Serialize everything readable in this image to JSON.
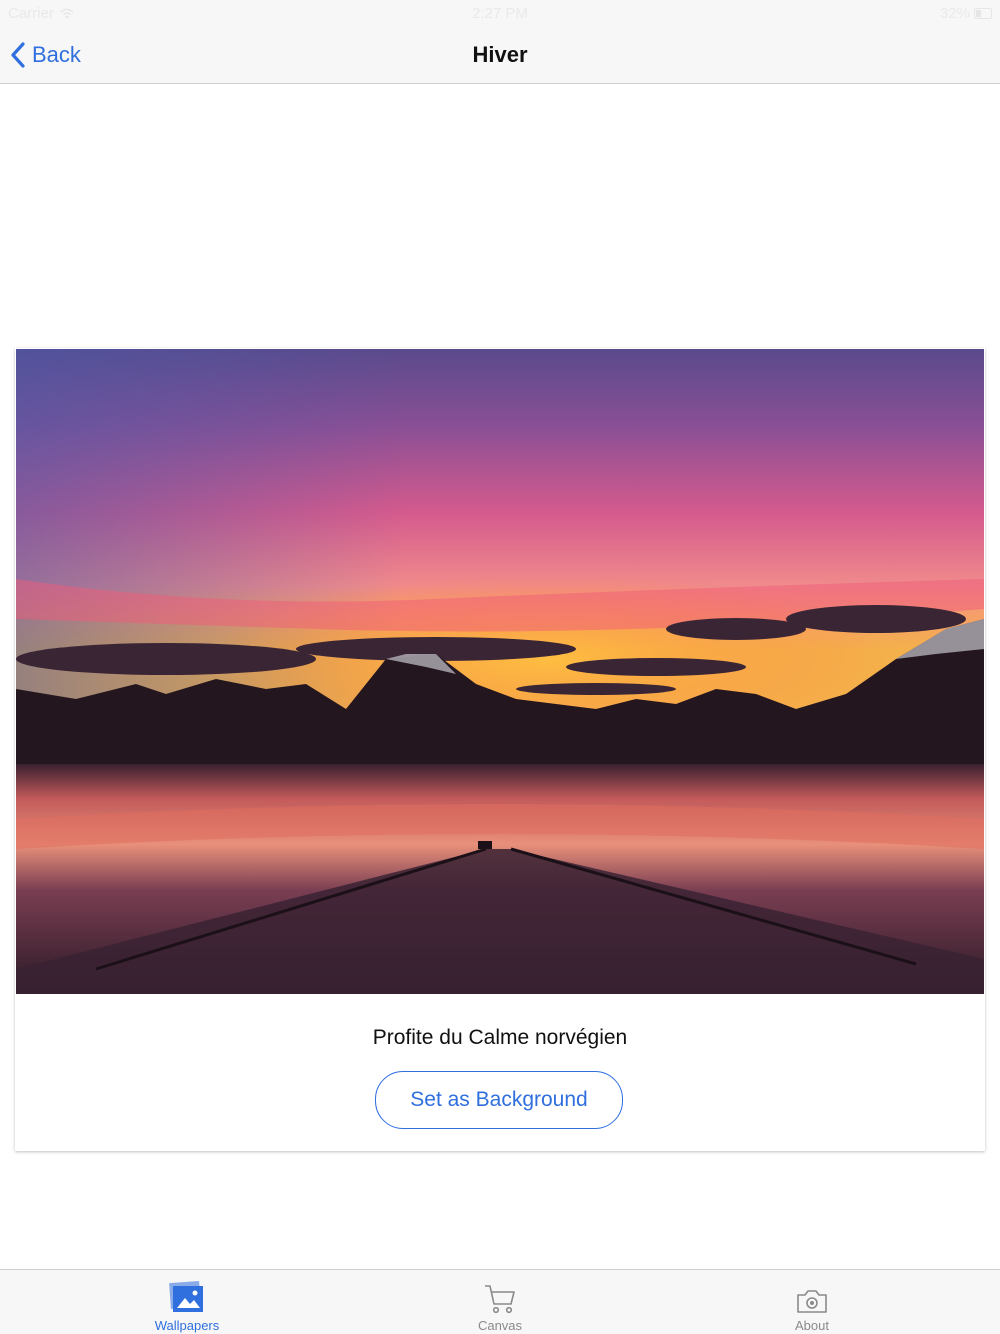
{
  "status_bar": {
    "carrier": "Carrier",
    "time": "2:27 PM",
    "battery": "32%"
  },
  "nav": {
    "back_label": "Back",
    "title": "Hiver"
  },
  "wallpaper": {
    "caption": "Profite du Calme norvégien",
    "set_button_label": "Set as Background"
  },
  "tabs": [
    {
      "label": "Wallpapers",
      "icon": "wallpapers-icon",
      "active": true
    },
    {
      "label": "Canvas",
      "icon": "cart-icon",
      "active": false
    },
    {
      "label": "About",
      "icon": "camera-icon",
      "active": false
    }
  ],
  "colors": {
    "accent": "#2f6fde",
    "bar_background": "#f7f7f7",
    "inactive_tab": "#8a8a8a"
  }
}
